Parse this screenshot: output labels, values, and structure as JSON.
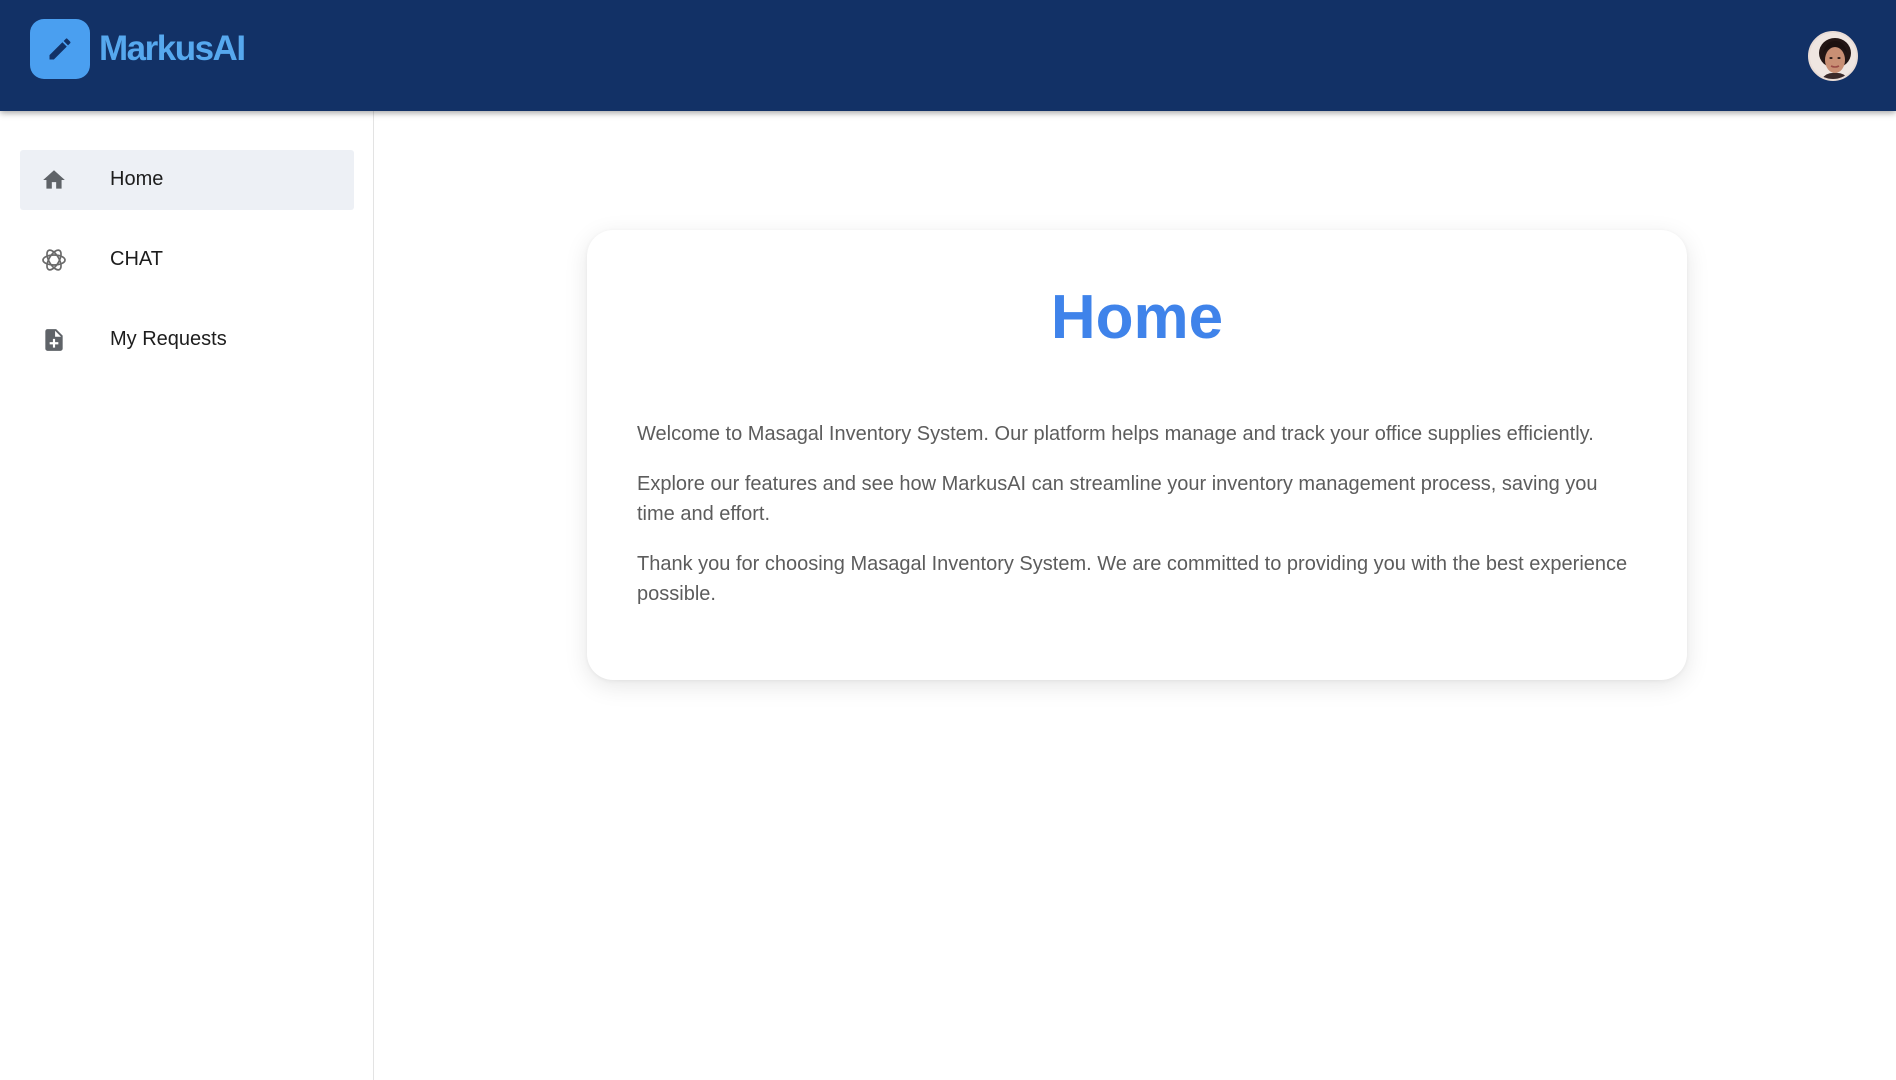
{
  "app": {
    "name": "MarkusAI",
    "logo_icon": "pencil-icon",
    "avatar_icon": "user-avatar"
  },
  "colors": {
    "header_bg": "#123166",
    "brand": "#56a8ee",
    "logo_bg": "#4a9ff0",
    "title": "#3f83ea",
    "active_nav_bg": "#edf0f5"
  },
  "sidebar": {
    "items": [
      {
        "label": "Home",
        "icon": "home-icon",
        "active": true
      },
      {
        "label": "CHAT",
        "icon": "openai-icon",
        "active": false
      },
      {
        "label": "My Requests",
        "icon": "file-add-icon",
        "active": false
      }
    ]
  },
  "main": {
    "title": "Home",
    "paragraphs": [
      "Welcome to Masagal Inventory System. Our platform helps manage and track your office supplies efficiently.",
      "Explore our features and see how MarkusAI can streamline your inventory management process, saving you time and effort.",
      "Thank you for choosing Masagal Inventory System. We are committed to providing you with the best experience possible."
    ]
  }
}
